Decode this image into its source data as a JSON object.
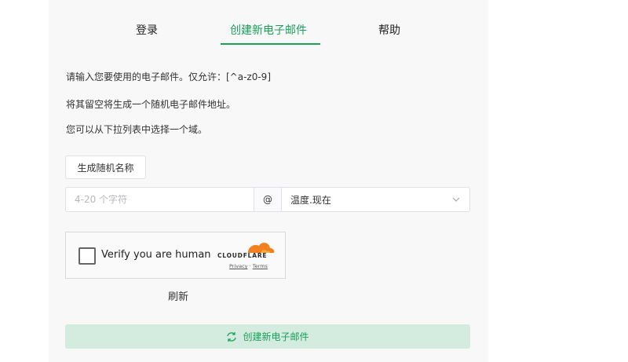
{
  "tabs": [
    {
      "label": "登录",
      "active": false
    },
    {
      "label": "创建新电子邮件",
      "active": true
    },
    {
      "label": "帮助",
      "active": false
    }
  ],
  "instructions": [
    "请输入您要使用的电子邮件。仅允许：[^a-z0-9]",
    "将其留空将生成一个随机电子邮件地址。",
    "您可以从下拉列表中选择一个域。"
  ],
  "random_name_button": "生成随机名称",
  "name_input": {
    "placeholder": "4-20 个字符",
    "value": ""
  },
  "at_sign": "@",
  "domain_select": {
    "selected": "温度.现在",
    "icon": "chevron-down-icon"
  },
  "captcha": {
    "label": "Verify you are human",
    "brand": "CLOUDFLARE",
    "privacy": "Privacy",
    "separator": "·",
    "terms": "Terms"
  },
  "refresh_label": "刷新",
  "create_button": {
    "label": "创建新电子邮件",
    "icon": "refresh-icon"
  },
  "colors": {
    "accent": "#18a058",
    "button_bg": "#d4ece0",
    "cloudflare": "#f38020"
  }
}
